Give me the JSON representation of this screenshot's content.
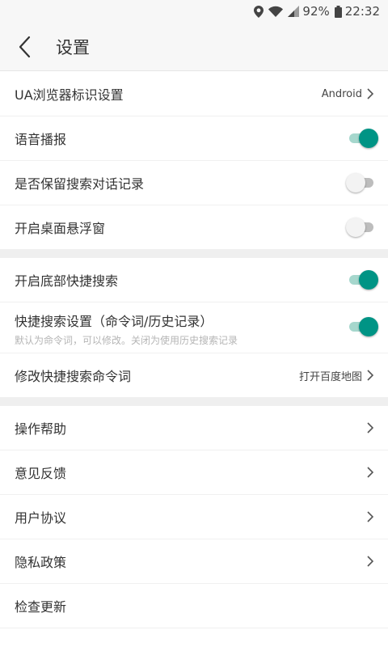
{
  "status_bar": {
    "battery": "92%",
    "time": "22:32",
    "icons": [
      "location-icon",
      "wifi-icon",
      "signal-icon",
      "battery-icon"
    ]
  },
  "header": {
    "title": "设置",
    "back_icon": "back-chevron-icon"
  },
  "settings": {
    "ua": {
      "label": "UA浏览器标识设置",
      "value": "Android"
    },
    "voice": {
      "label": "语音播报",
      "enabled": true
    },
    "keep_history": {
      "label": "是否保留搜索对话记录",
      "enabled": false
    },
    "float_window": {
      "label": "开启桌面悬浮窗",
      "enabled": false
    },
    "bottom_search": {
      "label": "开启底部快捷搜索",
      "enabled": true
    },
    "quick_mode": {
      "label": "快捷搜索设置（命令词/历史记录）",
      "desc": "默认为命令词，可以修改。关闭为使用历史搜索记录",
      "enabled": true
    },
    "quick_command": {
      "label": "修改快捷搜索命令词",
      "value": "打开百度地图"
    },
    "help": {
      "label": "操作帮助"
    },
    "feedback": {
      "label": "意见反馈"
    },
    "agreement": {
      "label": "用户协议"
    },
    "privacy": {
      "label": "隐私政策"
    },
    "update": {
      "label": "检查更新"
    }
  },
  "colors": {
    "accent": "#009485",
    "accent_track": "#a6d7cd",
    "section_gap": "#efefef",
    "header_bg": "#f7f7f7"
  }
}
